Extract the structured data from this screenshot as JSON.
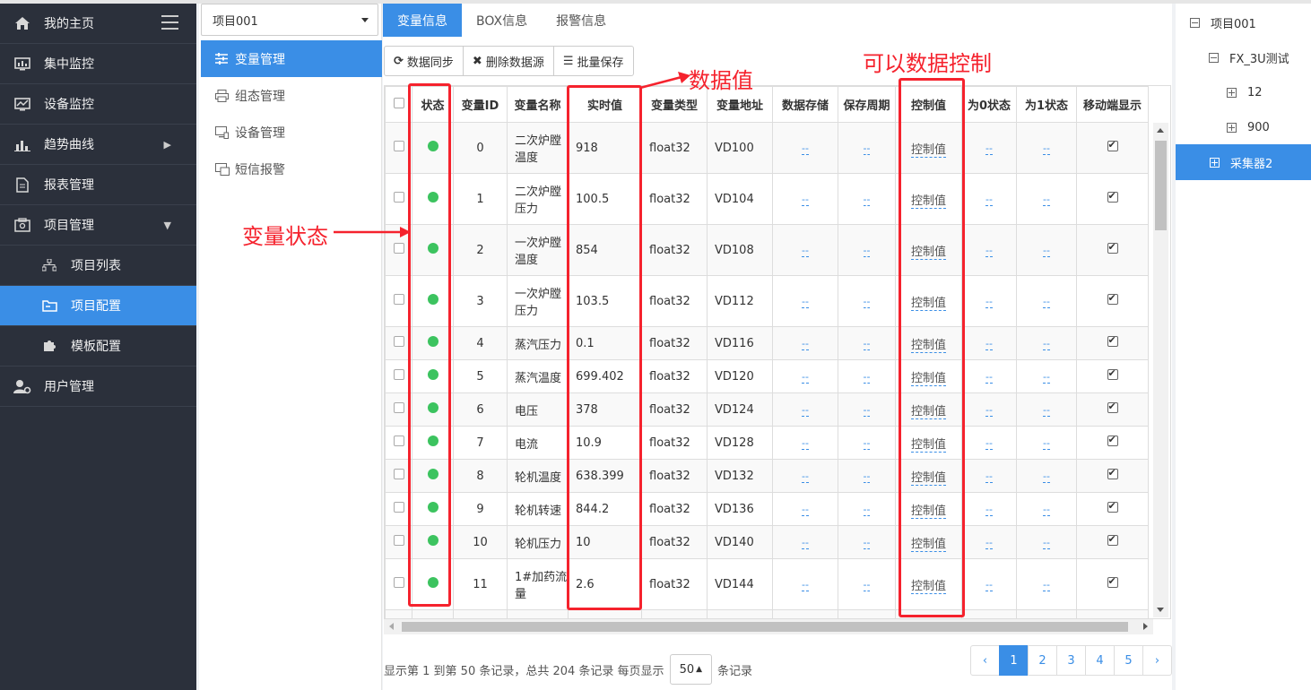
{
  "nav": {
    "items": [
      {
        "label": "我的主页",
        "icon": "home-icon"
      },
      {
        "label": "集中监控",
        "icon": "dashboard-icon"
      },
      {
        "label": "设备监控",
        "icon": "monitor-icon"
      },
      {
        "label": "趋势曲线",
        "icon": "bar-chart-icon"
      },
      {
        "label": "报表管理",
        "icon": "document-icon"
      },
      {
        "label": "项目管理",
        "icon": "project-icon"
      },
      {
        "label": "项目列表",
        "icon": "sitemap-icon"
      },
      {
        "label": "项目配置",
        "icon": "folder-config-icon"
      },
      {
        "label": "模板配置",
        "icon": "puzzle-icon"
      },
      {
        "label": "用户管理",
        "icon": "user-gear-icon"
      }
    ]
  },
  "panel2": {
    "project": "项目001",
    "items": [
      {
        "label": "变量管理"
      },
      {
        "label": "组态管理"
      },
      {
        "label": "设备管理"
      },
      {
        "label": "短信报警"
      }
    ]
  },
  "tabs": [
    "变量信息",
    "BOX信息",
    "报警信息"
  ],
  "toolbar": {
    "sync": "数据同步",
    "delete": "删除数据源",
    "save": "批量保存"
  },
  "table": {
    "headers": [
      "状态",
      "变量ID",
      "变量名称",
      "实时值",
      "变量类型",
      "变量地址",
      "数据存储",
      "保存周期",
      "控制值",
      "为0状态",
      "为1状态",
      "移动端显示"
    ],
    "rows": [
      {
        "id": "0",
        "name": "二次炉膛温度",
        "value": "918",
        "type": "float32",
        "addr": "VD100"
      },
      {
        "id": "1",
        "name": "二次炉膛压力",
        "value": "100.5",
        "type": "float32",
        "addr": "VD104"
      },
      {
        "id": "2",
        "name": "一次炉膛温度",
        "value": "854",
        "type": "float32",
        "addr": "VD108"
      },
      {
        "id": "3",
        "name": "一次炉膛压力",
        "value": "103.5",
        "type": "float32",
        "addr": "VD112"
      },
      {
        "id": "4",
        "name": "蒸汽压力",
        "value": "0.1",
        "type": "float32",
        "addr": "VD116"
      },
      {
        "id": "5",
        "name": "蒸汽温度",
        "value": "699.402",
        "type": "float32",
        "addr": "VD120"
      },
      {
        "id": "6",
        "name": "电压",
        "value": "378",
        "type": "float32",
        "addr": "VD124"
      },
      {
        "id": "7",
        "name": "电流",
        "value": "10.9",
        "type": "float32",
        "addr": "VD128"
      },
      {
        "id": "8",
        "name": "轮机温度",
        "value": "638.399",
        "type": "float32",
        "addr": "VD132"
      },
      {
        "id": "9",
        "name": "轮机转速",
        "value": "844.2",
        "type": "float32",
        "addr": "VD136"
      },
      {
        "id": "10",
        "name": "轮机压力",
        "value": "10",
        "type": "float32",
        "addr": "VD140"
      },
      {
        "id": "11",
        "name": "1#加药流量",
        "value": "2.6",
        "type": "float32",
        "addr": "VD144"
      }
    ],
    "dash": "--",
    "control_label": "控制值"
  },
  "footer": {
    "prefix": "显示第 1 到第 50 条记录，总共 204 条记录 每页显示",
    "page_size": "50",
    "suffix": "条记录",
    "pages": [
      "‹",
      "1",
      "2",
      "3",
      "4",
      "5",
      "›"
    ],
    "active_page": "1"
  },
  "tree": {
    "nodes": [
      {
        "label": "项目001",
        "expanded": true
      },
      {
        "label": "FX_3U测试",
        "expanded": true
      },
      {
        "label": "12",
        "expanded": false
      },
      {
        "label": "900",
        "expanded": false
      },
      {
        "label": "采集器2",
        "expanded": false
      }
    ]
  },
  "annotations": {
    "status": "变量状态",
    "value": "数据值",
    "control": "可以数据控制"
  },
  "colors": {
    "accent": "#3a8ee6",
    "nav_bg": "#2b303b",
    "status_ok": "#3cc35f",
    "annotation": "#f5222d"
  }
}
